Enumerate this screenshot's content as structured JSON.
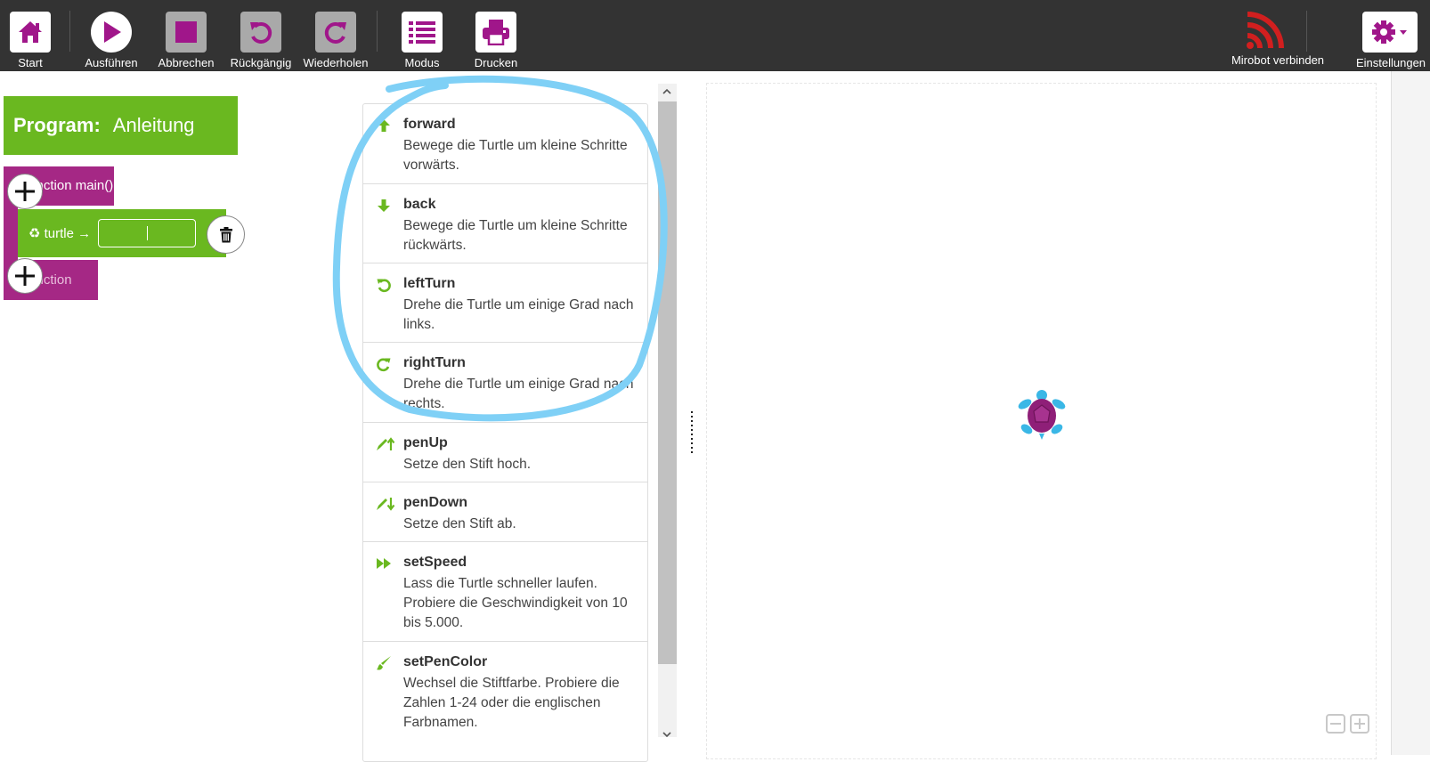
{
  "toolbar": {
    "start_label": "Start",
    "run_label": "Ausführen",
    "stop_label": "Abbrechen",
    "undo_label": "Rückgängig",
    "redo_label": "Wiederholen",
    "mode_label": "Modus",
    "print_label": "Drucken",
    "mirobot_label": "Mirobot verbinden",
    "settings_label": "Einstellungen"
  },
  "program": {
    "header_prefix": "Program:",
    "header_name": "Anleitung",
    "function_head": "function main()",
    "statement_label": "♻ turtle →",
    "statement_value": "",
    "function_end": "function"
  },
  "palette": {
    "commands": [
      {
        "name": "forward",
        "desc": "Bewege die Turtle um kleine Schritte vorwärts.",
        "icon": "arrow-up-icon"
      },
      {
        "name": "back",
        "desc": "Bewege die Turtle um kleine Schritte rückwärts.",
        "icon": "arrow-down-icon"
      },
      {
        "name": "leftTurn",
        "desc": "Drehe die Turtle um einige Grad nach links.",
        "icon": "rotate-left-icon"
      },
      {
        "name": "rightTurn",
        "desc": "Drehe die Turtle um einige Grad nach rechts.",
        "icon": "rotate-right-icon"
      },
      {
        "name": "penUp",
        "desc": "Setze den Stift hoch.",
        "icon": "pen-up-icon"
      },
      {
        "name": "penDown",
        "desc": "Setze den Stift ab.",
        "icon": "pen-down-icon"
      },
      {
        "name": "setSpeed",
        "desc": "Lass die Turtle schneller laufen. Probiere die Geschwindigkeit von 10 bis 5.000.",
        "icon": "fast-forward-icon"
      },
      {
        "name": "setPenColor",
        "desc": "Wechsel die Stiftfarbe. Probiere die Zahlen 1-24 oder die englischen Farbnamen.",
        "icon": "brush-icon"
      }
    ]
  },
  "colors": {
    "accent": "#a0168a",
    "green": "#6ab820",
    "function_purple": "#a52885",
    "toolbar": "#333333",
    "annotation": "#7fd0f6"
  }
}
